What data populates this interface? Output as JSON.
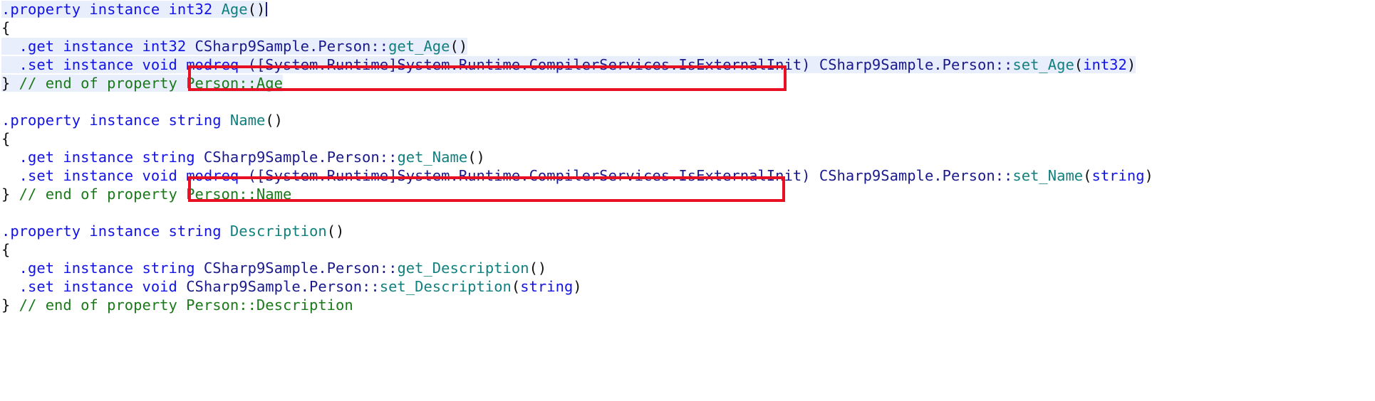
{
  "view": {
    "kind": "il-disassembly-code-view",
    "background_color": "#ffffff",
    "selection_highlight_color": "#e8eefc",
    "annotation_color": "#e81123"
  },
  "palette": {
    "keyword_blue": "#1313e6",
    "identifier_teal": "#12807f",
    "qualifier_navy": "#1a1a8c",
    "comment_green": "#1a7a1a",
    "punctuation_black": "#101010"
  },
  "code": {
    "age_property": {
      "line1": {
        "dot_property": ".property",
        "instance": " instance",
        "type": " int32",
        "name": " Age",
        "parens": "()"
      },
      "line2": {
        "brace": "{"
      },
      "line3": {
        "dot_get": "  .get",
        "instance": " instance",
        "type": " int32",
        "qualifier": " CSharp9Sample.Person::",
        "name": "get_Age",
        "parens": "()"
      },
      "line4": {
        "dot_set": "  .set",
        "instance": " instance",
        "type": " void",
        "modreq": " modreq",
        "modreq_arg": " ([System.Runtime]System.Runtime.CompilerServices.IsExternalInit)",
        "qualifier": " CSharp9Sample.Person::",
        "name": "set_Age",
        "open_paren": "(",
        "param_type": "int32",
        "close_paren": ")"
      },
      "line5": {
        "brace": "}",
        "comment": " // end of property Person::Age"
      }
    },
    "name_property": {
      "line1": {
        "dot_property": ".property",
        "instance": " instance",
        "type": " string",
        "name": " Name",
        "parens": "()"
      },
      "line2": {
        "brace": "{"
      },
      "line3": {
        "dot_get": "  .get",
        "instance": " instance",
        "type": " string",
        "qualifier": " CSharp9Sample.Person::",
        "name": "get_Name",
        "parens": "()"
      },
      "line4": {
        "dot_set": "  .set",
        "instance": " instance",
        "type": " void",
        "modreq": " modreq",
        "modreq_arg": " ([System.Runtime]System.Runtime.CompilerServices.IsExternalInit)",
        "qualifier": " CSharp9Sample.Person::",
        "name": "set_Name",
        "open_paren": "(",
        "param_type": "string",
        "close_paren": ")"
      },
      "line5": {
        "brace": "}",
        "comment": " // end of property Person::Name"
      }
    },
    "description_property": {
      "line1": {
        "dot_property": ".property",
        "instance": " instance",
        "type": " string",
        "name": " Description",
        "parens": "()"
      },
      "line2": {
        "brace": "{"
      },
      "line3": {
        "dot_get": "  .get",
        "instance": " instance",
        "type": " string",
        "qualifier": " CSharp9Sample.Person::",
        "name": "get_Description",
        "parens": "()"
      },
      "line4": {
        "dot_set": "  .set",
        "instance": " instance",
        "type": " void",
        "qualifier": " CSharp9Sample.Person::",
        "name": "set_Description",
        "open_paren": "(",
        "param_type": "string",
        "close_paren": ")"
      },
      "line5": {
        "brace": "}",
        "comment": " // end of property Person::Description"
      }
    }
  },
  "annotations": {
    "age_modreq_box": {
      "label": "modreq-isexternalinit-highlight-age"
    },
    "name_modreq_box": {
      "label": "modreq-isexternalinit-highlight-name"
    }
  }
}
